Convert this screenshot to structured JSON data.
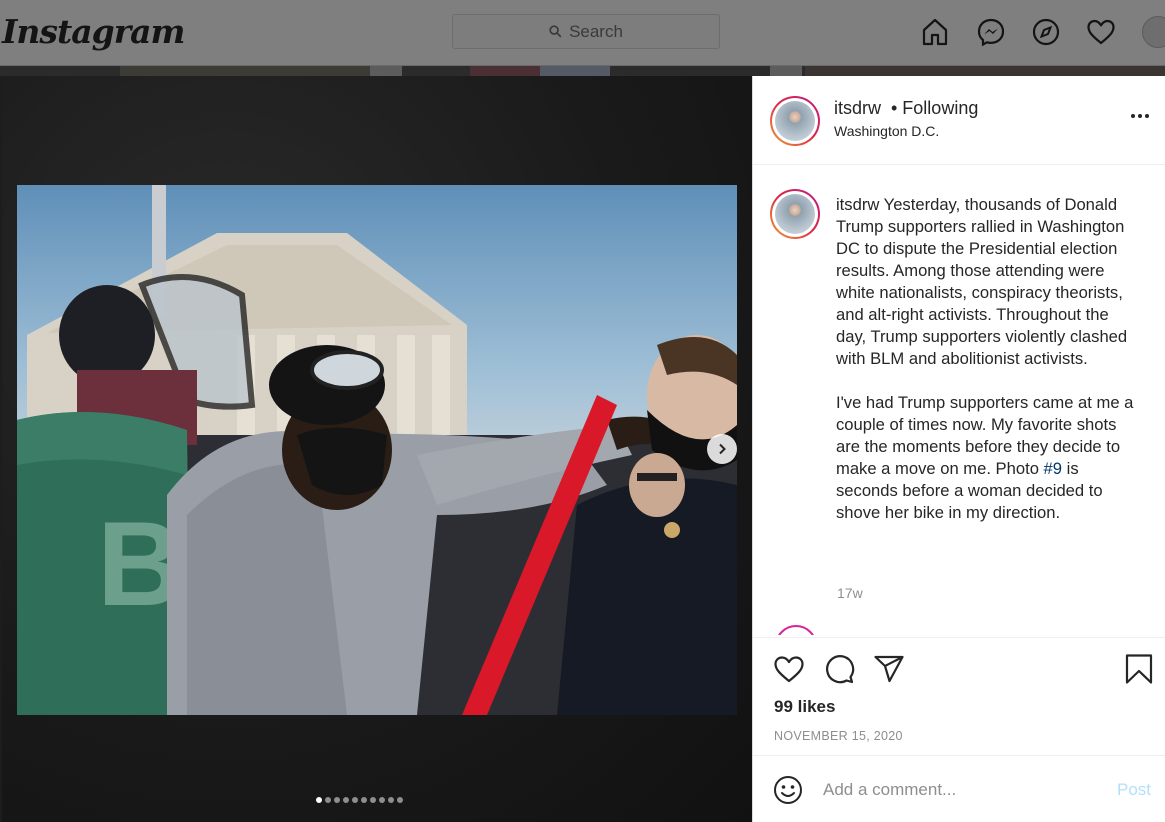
{
  "header": {
    "logo": "Instagram",
    "search_placeholder": "Search",
    "icons": [
      "home-icon",
      "messenger-icon",
      "explore-icon",
      "activity-heart-icon",
      "profile-avatar"
    ]
  },
  "carousel": {
    "total_slides": 10,
    "active_index": 0,
    "next_icon": "chevron-right-icon"
  },
  "post": {
    "username": "itsdrw",
    "follow_status": "• Following",
    "location": "Washington D.C.",
    "caption": {
      "username": "itsdrw",
      "paragraph_1": "Yesterday, thousands of Donald Trump supporters rallied in Washington DC to dispute the Presidential election results. Among those attending were white nationalists, conspiracy theorists, and alt-right activists. Throughout the day, Trump supporters violently clashed with BLM and abolitionist activists.",
      "paragraph_2_before": "I've had Trump supporters came at me a couple of times now. My favorite shots are the moments before they decide to make a move on me. Photo",
      "hashtag": "#9",
      "paragraph_2_after": "is seconds before a woman decided to shove her bike in my direction."
    },
    "age": "17w",
    "likes": "99 likes",
    "date": "NOVEMBER 15, 2020"
  },
  "comment": {
    "placeholder": "Add a comment...",
    "post_label": "Post"
  },
  "colors": {
    "link": "#00376b",
    "post_disabled": "#b2dffc",
    "story_ring": "#dc2743"
  }
}
